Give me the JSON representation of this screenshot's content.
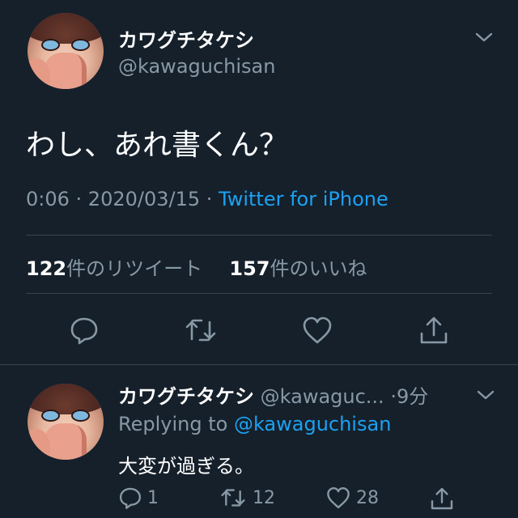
{
  "main_tweet": {
    "display_name": "カワグチタケシ",
    "handle": "@kawaguchisan",
    "text": "わし、あれ書くん？",
    "time": "0:06",
    "separator": " · ",
    "date": "2020/03/15",
    "source": "Twitter for iPhone",
    "retweet_count": "122",
    "retweet_label": "件のリツイート",
    "like_count": "157",
    "like_label": "件のいいね"
  },
  "reply": {
    "display_name": "カワグチタケシ",
    "handle": "@kawaguc...",
    "time": "·9分",
    "replying_prefix": "Replying to ",
    "replying_handle": "@kawaguchisan",
    "text": "大変が過ぎる。",
    "reply_count": "1",
    "retweet_count": "12",
    "like_count": "28"
  },
  "icons": {
    "menu": "chevron-down-icon",
    "reply": "reply-icon",
    "retweet": "retweet-icon",
    "like": "heart-icon",
    "share": "share-icon"
  },
  "colors": {
    "background": "#15202b",
    "text": "#ffffff",
    "secondary": "#8899a6",
    "link": "#1da1f2",
    "divider": "#38444d"
  }
}
